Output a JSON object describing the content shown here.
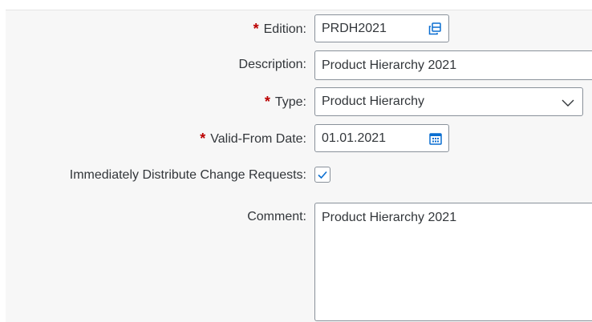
{
  "form": {
    "edition": {
      "required_mark": "*",
      "label": "Edition:",
      "value": "PRDH2021",
      "icon": "value-help-icon"
    },
    "description": {
      "label": "Description:",
      "value": "Product Hierarchy 2021"
    },
    "type": {
      "required_mark": "*",
      "label": "Type:",
      "value": "Product Hierarchy",
      "icon": "chevron-down-icon"
    },
    "valid_from": {
      "required_mark": "*",
      "label": "Valid-From Date:",
      "value": "01.01.2021",
      "icon": "calendar-icon"
    },
    "distribute": {
      "label": "Immediately Distribute Change Requests:",
      "checked": true
    },
    "comment": {
      "label": "Comment:",
      "value": "Product Hierarchy 2021"
    }
  },
  "colors": {
    "background": "#f7f7f7",
    "required": "#bb0000",
    "border": "#89919a",
    "accent": "#0a6ed1",
    "text": "#32363a"
  }
}
